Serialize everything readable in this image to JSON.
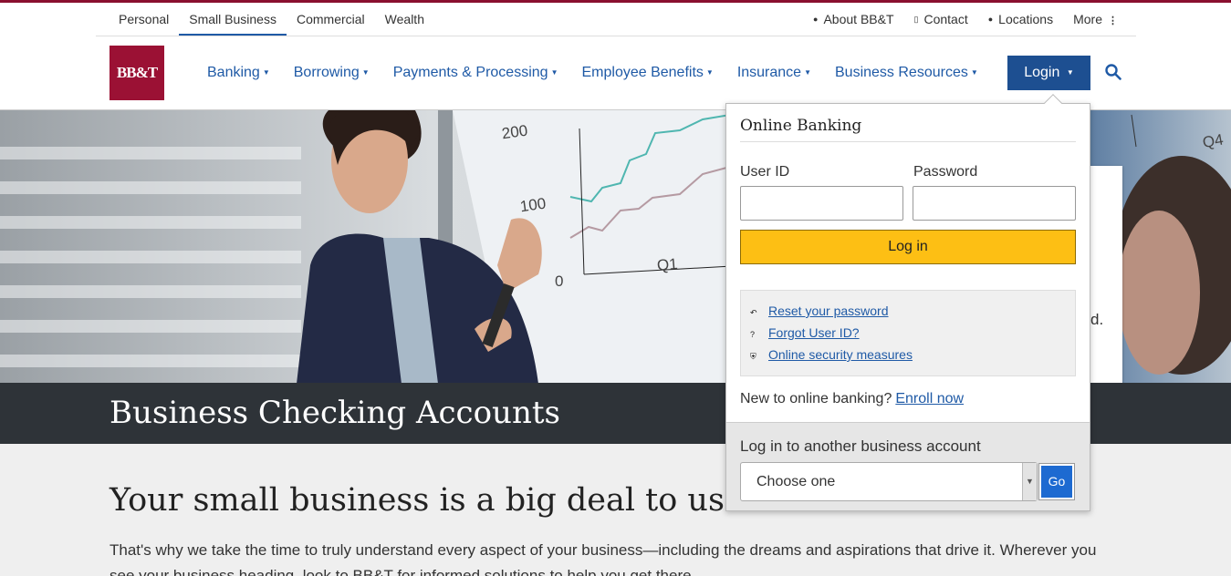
{
  "utility": {
    "segments": [
      "Personal",
      "Small Business",
      "Commercial",
      "Wealth"
    ],
    "active_segment": "Small Business",
    "links": [
      {
        "label": "About BB&T",
        "icon": "person-icon"
      },
      {
        "label": "Contact",
        "icon": "phone-icon"
      },
      {
        "label": "Locations",
        "icon": "location-pin-icon"
      },
      {
        "label": "More",
        "icon": "more-vertical-icon"
      }
    ]
  },
  "brand": {
    "logo_text": "BB&T",
    "color": "#9b1134"
  },
  "nav": {
    "items": [
      "Banking",
      "Borrowing",
      "Payments & Processing",
      "Employee Benefits",
      "Insurance",
      "Business Resources"
    ],
    "login_label": "Login",
    "accent": "#1f5aa6"
  },
  "hero": {
    "chart_ticks": [
      "200",
      "100",
      "0"
    ],
    "quarters": [
      "Q1",
      "Q4"
    ],
    "banner_title": "Business Checking Accounts",
    "behind_card_text": "d."
  },
  "content": {
    "heading": "Your small business is a big deal to us",
    "paragraph": "That's why we take the time to truly understand every aspect of your business—including the dreams and aspirations that drive it. Wherever you see your business heading, look to BB&T for informed solutions to help you get there."
  },
  "login_panel": {
    "title": "Online Banking",
    "user_id_label": "User ID",
    "user_id_value": "",
    "password_label": "Password",
    "password_value": "",
    "submit_label": "Log in",
    "help_links": [
      {
        "label": "Reset your password",
        "icon": "reset-icon"
      },
      {
        "label": "Forgot User ID?",
        "icon": "question-icon"
      },
      {
        "label": "Online security measures",
        "icon": "shield-icon"
      }
    ],
    "enroll_prompt": "New to online banking?",
    "enroll_link": "Enroll now",
    "other_account_title": "Log in to another business account",
    "select_value": "Choose one",
    "go_label": "Go",
    "button_color": "#fdbf14"
  }
}
